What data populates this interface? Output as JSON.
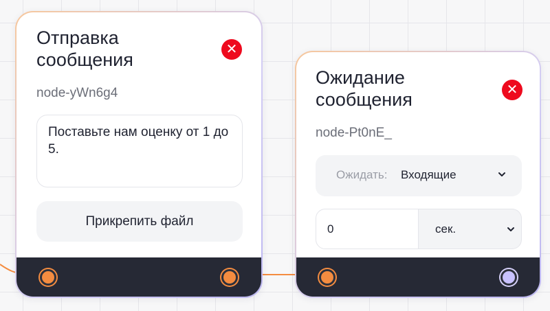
{
  "nodes": [
    {
      "title": "Отправка сообщения",
      "id": "node-yWn6g4",
      "message": "Поставьте нам оценку от 1 до 5.",
      "attach_label": "Прикрепить файл",
      "close_symbol": "✕"
    },
    {
      "title": "Ожидание сообщения",
      "id": "node-Pt0nE_",
      "wait_label": "Ожидать:",
      "wait_value": "Входящие",
      "timeout_value": "0",
      "unit_value": "сек.",
      "close_symbol": "✕"
    }
  ],
  "icons": {
    "close": "close-icon",
    "dropdown": "chevron-down-icon"
  },
  "colors": {
    "close": "#ee0a1e",
    "port_orange": "#f48c40",
    "port_purple": "#c8c1ff",
    "footer": "#262935",
    "wire": "#f48c40"
  }
}
